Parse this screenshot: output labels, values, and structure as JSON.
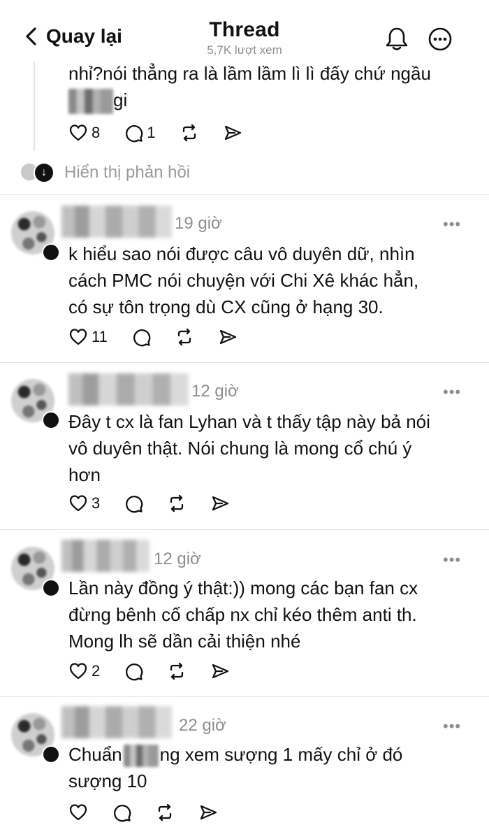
{
  "header": {
    "back_label": "Quay lại",
    "title": "Thread",
    "views": "5,7K lượt xem"
  },
  "top_reply": {
    "line1": "nhỉ?nói thẳng ra là lầm lầm lì lì đấy chứ ngầu",
    "line2_suffix": "gi",
    "likes": "8",
    "comments": "1"
  },
  "show_replies_label": "Hiển thị phản hồi",
  "posts": [
    {
      "time": "19 giờ",
      "lines": [
        "k hiểu sao nói được câu vô duyên dữ, nhìn",
        "cách PMC nói chuyện với Chi Xê khác hẳn,",
        "có sự tôn trọng dù CX cũng ở hạng 30."
      ],
      "likes": "11"
    },
    {
      "time": "12 giờ",
      "lines": [
        "Đây t cx là fan Lyhan và t thấy tập này bả nói",
        "vô duyên thật. Nói chung là mong cổ chú ý",
        "hơn"
      ],
      "likes": "3"
    },
    {
      "time": "12 giờ",
      "lines": [
        "Lần này đồng ý thật:)) mong các bạn fan cx",
        "đừng bênh cố chấp nx chỉ kéo thêm anti th.",
        "Mong lh sẽ dần cải thiện nhé"
      ],
      "likes": "2"
    },
    {
      "time": "22 giờ",
      "line1_prefix": "Chuẩn",
      "line1_suffix": "ng xem sượng 1 mấy chỉ ở đó",
      "line2": "sượng 10"
    }
  ],
  "more_glyph": "•••",
  "colors": {
    "text": "#111111",
    "muted": "#8e8e8e",
    "divider": "#e6e6e6"
  }
}
